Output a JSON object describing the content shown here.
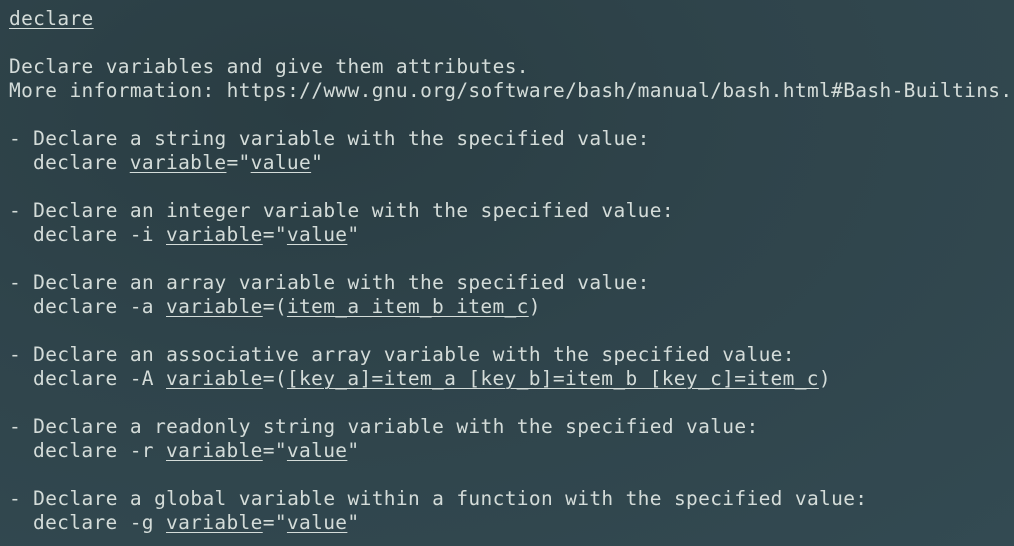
{
  "page": {
    "title": "declare",
    "description": "Declare variables and give them attributes.",
    "more_info_label": "More information: ",
    "more_info_url": "https://www.gnu.org/software/bash/manual/bash.html#Bash-Builtins."
  },
  "examples": [
    {
      "desc": "- Declare a string variable with the specified value:",
      "cmd": "declare ",
      "var": "variable",
      "eq": "=\"",
      "val": "value",
      "end": "\""
    },
    {
      "desc": "- Declare an integer variable with the specified value:",
      "cmd": "declare -i ",
      "var": "variable",
      "eq": "=\"",
      "val": "value",
      "end": "\""
    },
    {
      "desc": "- Declare an array variable with the specified value:",
      "cmd": "declare -a ",
      "var": "variable",
      "eq": "=(",
      "val": "item_a item_b item_c",
      "end": ")"
    },
    {
      "desc": "- Declare an associative array variable with the specified value:",
      "cmd": "declare -A ",
      "var": "variable",
      "eq": "=(",
      "val": "[key_a]=item_a [key_b]=item_b [key_c]=item_c",
      "end": ")"
    },
    {
      "desc": "- Declare a readonly string variable with the specified value:",
      "cmd": "declare -r ",
      "var": "variable",
      "eq": "=\"",
      "val": "value",
      "end": "\""
    },
    {
      "desc": "- Declare a global variable within a function with the specified value:",
      "cmd": "declare -g ",
      "var": "variable",
      "eq": "=\"",
      "val": "value",
      "end": "\""
    }
  ],
  "colors": {
    "background": "#2f444b",
    "text": "#d4dcd9"
  }
}
